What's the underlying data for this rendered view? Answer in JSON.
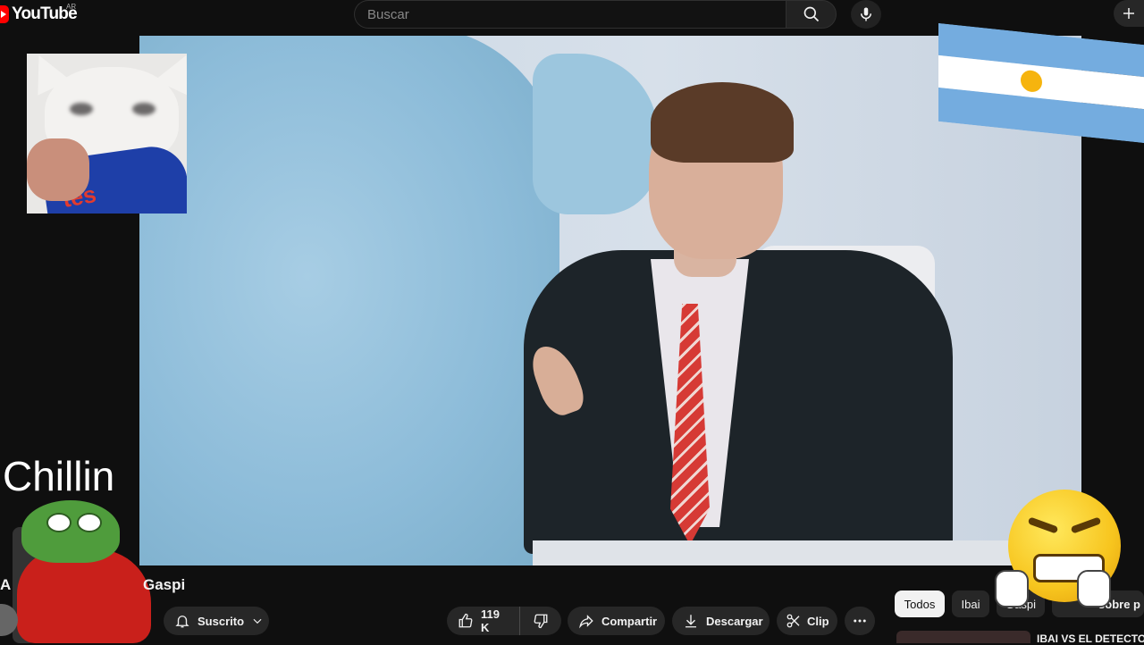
{
  "header": {
    "logo_text": "YouTube",
    "country_code": "AR",
    "search_placeholder": "Buscar"
  },
  "overlays": {
    "chillin_text": "Chillin",
    "bag_text": "tes"
  },
  "video": {
    "title_start": "A",
    "title_end": "Gaspi"
  },
  "actions": {
    "subscribe_label": "Suscrito",
    "likes_count": "119 K",
    "share_label": "Compartir",
    "download_label": "Descargar",
    "clip_label": "Clip"
  },
  "chips": [
    {
      "label": "Todos",
      "active": true
    },
    {
      "label": "Ibai",
      "active": false
    },
    {
      "label": "Gaspi",
      "active": false
    },
    {
      "label": "sobre p",
      "active": false
    }
  ],
  "recommendation": {
    "title": "IBAI VS EL DETECTOR"
  },
  "colors": {
    "background": "#0f0f0f",
    "brand_red": "#ff0000",
    "pill": "#272727"
  }
}
